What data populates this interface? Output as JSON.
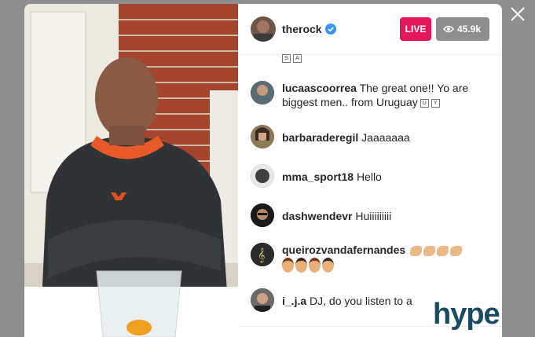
{
  "header": {
    "username": "therock",
    "live_label": "LIVE",
    "viewer_count": "45.9k"
  },
  "partial_comment": {
    "letters": [
      "S",
      "A"
    ]
  },
  "comments": [
    {
      "username": "lucaascoorrea",
      "text": "The great one!! Yo are biggest men.. from Uruguay",
      "letters": [
        "U",
        "Y"
      ]
    },
    {
      "username": "barbaraderegil",
      "text": "Jaaaaaaa"
    },
    {
      "username": "mma_sport18",
      "text": "Hello"
    },
    {
      "username": "dashwendevr",
      "text": "Huiiiiiiiii"
    },
    {
      "username": "queirozvandafernandes",
      "text": ""
    },
    {
      "username": "i_.j.a",
      "text": "DJ, do you listen to a"
    }
  ],
  "watermark": {
    "text": "hype"
  },
  "colors": {
    "live_badge": "#e2185b",
    "viewer_badge": "#8e8e8e",
    "backdrop": "#8e8e8e",
    "verified": "#3897f0",
    "watermark": "#1b4a63"
  }
}
